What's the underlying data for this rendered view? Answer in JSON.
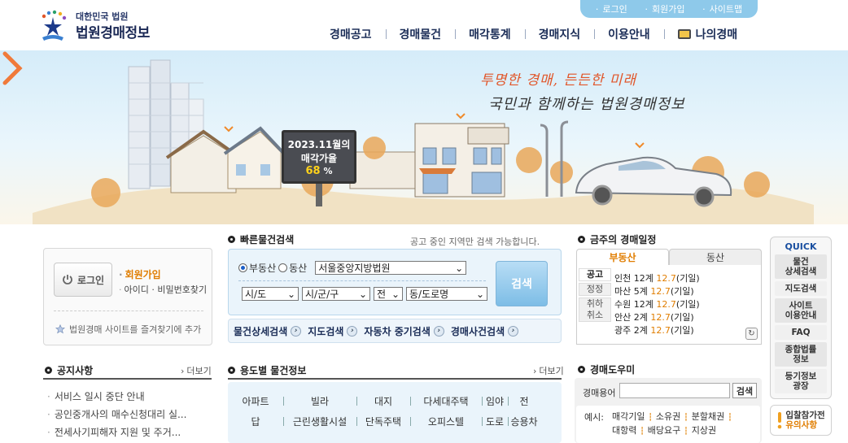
{
  "header": {
    "logo_sub": "대한민국 법원",
    "logo_main": "법원경매정보",
    "util": [
      "로그인",
      "회원가입",
      "사이트맵"
    ],
    "gnb": [
      "경매공고",
      "경매물건",
      "매각통계",
      "경매지식",
      "이용안내",
      "나의경매"
    ]
  },
  "hero": {
    "slogan_line1": "투명한 경매, 든든한 미래",
    "slogan_line2": "국민과 함께하는 법원경매정보",
    "billboard_line1": "2023.11월의",
    "billboard_line2": "매각가율",
    "billboard_rate": "68",
    "billboard_unit": "%"
  },
  "login": {
    "button": "로그인",
    "join": "회원가입",
    "find": "아이디 · 비밀번호찾기",
    "favorite": "법원경매 사이트를 즐겨찾기에 추가"
  },
  "quick_search": {
    "title": "빠른물건검색",
    "note": "공고 중인 지역만 검색 가능합니다.",
    "radio_realestate": "부동산",
    "radio_movable": "동산",
    "court": "서울중앙지방법원",
    "sido": "시/도",
    "sigungu": "시/군/구",
    "jeon": "전",
    "dong": "동/도로명",
    "search": "검색",
    "links": [
      "물건상세검색",
      "지도검색",
      "자동차 중기검색",
      "경매사건검색"
    ]
  },
  "weekly": {
    "title": "금주의 경매일정",
    "tabs": [
      "부동산",
      "동산"
    ],
    "cats": [
      "공고",
      "정정",
      "취하\n취소"
    ],
    "items": [
      {
        "place": "인천 12계",
        "date": "12.7",
        "tail": "(기일)"
      },
      {
        "place": "마산 5계",
        "date": "12.7",
        "tail": "(기일)"
      },
      {
        "place": "수원 12계",
        "date": "12.7",
        "tail": "(기일)"
      },
      {
        "place": "안산 2계",
        "date": "12.7",
        "tail": "(기일)"
      },
      {
        "place": "광주 2계",
        "date": "12.7",
        "tail": "(기일)"
      }
    ]
  },
  "quick_menu": {
    "title": "QUICK",
    "items": [
      "물건\n상세검색",
      "지도검색",
      "사이트\n이용안내",
      "FAQ",
      "종합법률\n정보",
      "등기정보\n광장"
    ],
    "notice_line1": "입찰참가전",
    "notice_line2": "유의사항"
  },
  "notices": {
    "title": "공지사항",
    "more": "더보기",
    "items": [
      "서비스 일시 중단 안내",
      "공인중개사의 매수신청대리 실...",
      "전세사기피해자 지원 및 주거..."
    ]
  },
  "usage": {
    "title": "용도별 물건정보",
    "more": "더보기",
    "row1": [
      "아파트",
      "빌라",
      "대지",
      "다세대주택",
      "임야",
      "전"
    ],
    "row2": [
      "답",
      "근린생활시설",
      "단독주택",
      "오피스텔",
      "도로",
      "승용차"
    ]
  },
  "glossary": {
    "title": "경매도우미",
    "label": "경매용어",
    "button": "검색",
    "example_label": "예시:",
    "terms": [
      "매각기일",
      "소유권",
      "분할채권",
      "대항력",
      "배당요구",
      "지상권"
    ]
  }
}
